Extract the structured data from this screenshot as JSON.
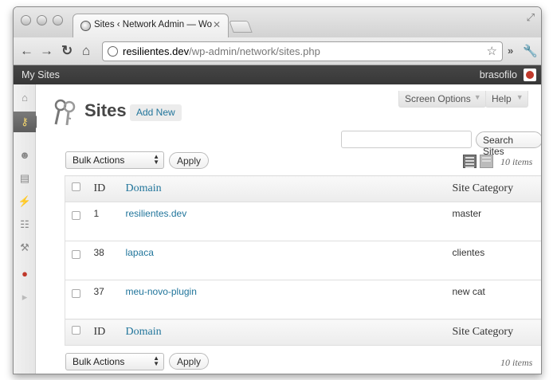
{
  "browser": {
    "tab_title": "Sites ‹ Network Admin — Wo",
    "tab_close": "✕",
    "url_host": "resilientes.dev",
    "url_path": "/wp-admin/network/sites.php",
    "more_label": "»"
  },
  "adminbar": {
    "my_sites": "My Sites",
    "username": "brasofilo"
  },
  "menu": [
    {
      "icon": "dashboard-icon",
      "glyph": "⌂"
    },
    {
      "icon": "sites-icon",
      "glyph": "⚷",
      "current": true
    },
    {
      "icon": "users-icon",
      "glyph": "☻"
    },
    {
      "icon": "themes-icon",
      "glyph": "▤"
    },
    {
      "icon": "plugins-icon",
      "glyph": "⚡"
    },
    {
      "icon": "settings-icon",
      "glyph": "☷"
    },
    {
      "icon": "tools-icon",
      "glyph": "⚒"
    },
    {
      "icon": "plugin-custom-icon",
      "glyph": "●"
    },
    {
      "icon": "collapse-icon",
      "glyph": "▸"
    }
  ],
  "header": {
    "screen_options": "Screen Options",
    "help": "Help",
    "title": "Sites",
    "add_new": "Add New",
    "search_button": "Search Sites",
    "search_value": ""
  },
  "tablenav": {
    "bulk_actions": "Bulk Actions",
    "apply": "Apply",
    "items_count": "10 items"
  },
  "table": {
    "columns": [
      "ID",
      "Domain",
      "Site Category"
    ],
    "rows": [
      {
        "id": "1",
        "domain": "resilientes.dev",
        "category": "master"
      },
      {
        "id": "38",
        "domain": "lapaca",
        "category": "clientes"
      },
      {
        "id": "37",
        "domain": "meu-novo-plugin",
        "category": "new cat"
      }
    ]
  },
  "colors": {
    "link": "#21759b",
    "adminbar": "#464646"
  }
}
